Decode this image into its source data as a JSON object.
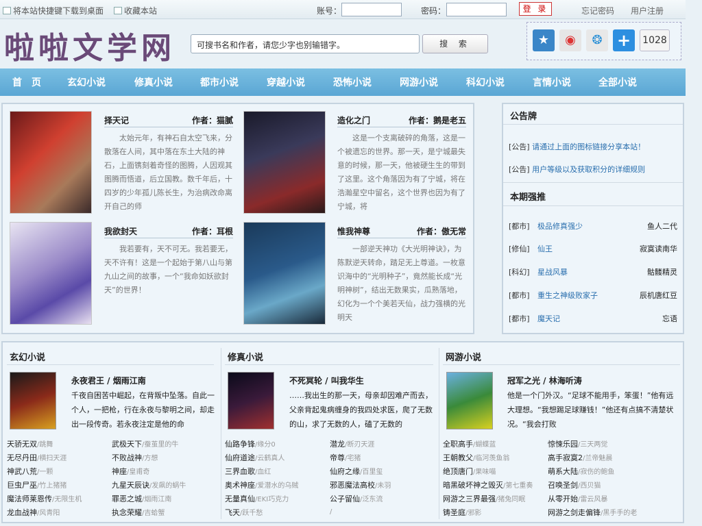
{
  "topbar": {
    "shortcut": "将本站快捷键下载到桌面",
    "favorite": "收藏本站",
    "account_label": "账号：",
    "password_label": "密码：",
    "login": "登 录",
    "forgot": "忘记密码",
    "register": "用户注册"
  },
  "header": {
    "logo": "啦啦文学网",
    "search_value": "可搜书名和作者，请您少字也别输错字。",
    "search_button": "搜 索",
    "share_count": "1028"
  },
  "nav": [
    "首　页",
    "玄幻小说",
    "修真小说",
    "都市小说",
    "穿越小说",
    "恐怖小说",
    "网游小说",
    "科幻小说",
    "言情小说",
    "全部小说"
  ],
  "featured": [
    {
      "title": "择天记",
      "author": "作者：猫腻",
      "desc": "太始元年，有神石自太空飞来，分散落在人间，其中落在东土大陆的神石，上面镌刻着奇怪的图腾，人因观其图腾而悟道，后立国教。数千年后，十四岁的少年孤儿陈长生，为治病改命离开自己的师"
    },
    {
      "title": "造化之门",
      "author": "作者：鹅是老五",
      "desc": "这是一个支离破碎的角落，这是一个被遗忘的世界。那一天，是宁城最失意的时候，那一天，他被硬生生的带到了这里。这个角落因为有了宁城，将在浩瀚星空中留名，这个世界也因为有了宁城，将"
    },
    {
      "title": "我欲封天",
      "author": "作者：耳根",
      "desc": "我若要有，天不可无。我若要无，天不许有！这是一个起始于第八山与第九山之间的故事，一个“我命如妖欲封天”的世界！"
    },
    {
      "title": "惟我神尊",
      "author": "作者：傲无常",
      "desc": "一部逆天神功《大光明神诀》，为陈默逆天转命，踏足无上尊道。一枚意识海中的“光明种子”，竟然能长成“光明神树”，结出无数果实，瓜熟落地，幻化为一个个美若天仙，战力强横的光明天"
    }
  ],
  "notice": {
    "title": "公告牌",
    "items": [
      {
        "tag": "[公告]",
        "text": "请通过上面的图标链接分享本站！"
      },
      {
        "tag": "[公告]",
        "text": "用户等级以及获取积分的详细规则"
      }
    ]
  },
  "recommend": {
    "title": "本期强推",
    "items": [
      {
        "tag": "[都市]",
        "title": "极品修真强少",
        "author": "鱼人二代"
      },
      {
        "tag": "[修仙]",
        "title": "仙王",
        "author": "寂寞读南华"
      },
      {
        "tag": "[科幻]",
        "title": "星战风暴",
        "author": "骷髅精灵"
      },
      {
        "tag": "[都市]",
        "title": "重生之神级败家子",
        "author": "辰机唐红豆"
      },
      {
        "tag": "[都市]",
        "title": "魔天记",
        "author": "忘语"
      }
    ]
  },
  "sections": [
    {
      "title": "玄幻小说",
      "feature": {
        "title": "永夜君王 / 烟雨江南",
        "desc": "千夜自困苦中崛起，在背叛中坠落。自此一个人，一把枪，行在永夜与黎明之间，却走出一段传奇。若永夜注定是他的命"
      },
      "col1": [
        [
          "天骄无双",
          "/跳舞"
        ],
        [
          "无尽丹田",
          "/横扫天涯"
        ],
        [
          "神武八荒",
          "/一颗"
        ],
        [
          "巨虫尸巫",
          "/竹上猪猪"
        ],
        [
          "魔法师莱恩传",
          "/无限生机"
        ],
        [
          "龙血战神",
          "/风青阳"
        ]
      ],
      "col2": [
        [
          "武极天下",
          "/蚕茧里的牛"
        ],
        [
          "不败战神",
          "/方想"
        ],
        [
          "神座",
          "/皇甫奇"
        ],
        [
          "九星天辰诀",
          "/发飙的蜗牛"
        ],
        [
          "罪恶之城",
          "/烟雨江南"
        ],
        [
          "执念荣耀",
          "/吉蛤蟹"
        ]
      ]
    },
    {
      "title": "修真小说",
      "feature": {
        "title": "不死冥轮 / 叫我华生",
        "desc": "……我出生的那一天，母亲却因难产而去，父亲背起鬼病缠身的我四处求医，爬了无数的山，求了无数的人，磕了无数的"
      },
      "col1": [
        [
          "仙路争锋",
          "/缘分0"
        ],
        [
          "仙府道途",
          "/云鹤真人"
        ],
        [
          "三界血歌",
          "/血红"
        ],
        [
          "奥术神座",
          "/爱潜水的乌贼"
        ],
        [
          "无量真仙",
          "/EKI巧克力"
        ],
        [
          "飞天",
          "/跃千愁"
        ]
      ],
      "col2": [
        [
          "潜龙",
          "/断刃天涯"
        ],
        [
          "帝尊",
          "/宅猪"
        ],
        [
          "仙府之缘",
          "/百里玺"
        ],
        [
          "邪恶魔法高校",
          "/未羽"
        ],
        [
          "公子留仙",
          "/泛东流"
        ],
        [
          "",
          "/"
        ]
      ]
    },
    {
      "title": "网游小说",
      "feature": {
        "title": "冠军之光 / 林海听涛",
        "desc": "他是一个门外汉。“足球不能用手，笨蛋！”他有远大理想。“我想踢足球赚钱！”他还有点搞不清楚状况。“我会打败"
      },
      "col1": [
        [
          "全职高手",
          "/蝴蝶蓝"
        ],
        [
          "王朝教父",
          "/临河羡鱼翁"
        ],
        [
          "绝顶唐门",
          "/果味喵"
        ],
        [
          "暗黑破坏神之毁灭",
          "/第七重奏"
        ],
        [
          "网游之三界最强",
          "/猪兔同眠"
        ],
        [
          "铸圣庭",
          "/邪影"
        ]
      ],
      "col2": [
        [
          "惊悚乐园",
          "/三天两觉"
        ],
        [
          "高手寂寞2",
          "/兰帝魅晨"
        ],
        [
          "萌系大陆",
          "/寂伤的鲍鱼"
        ],
        [
          "召唤圣剑",
          "/西贝猫"
        ],
        [
          "从零开始",
          "/雷云风暴"
        ],
        [
          "网游之剑走偏锋",
          "/黑手手的老"
        ]
      ]
    }
  ]
}
